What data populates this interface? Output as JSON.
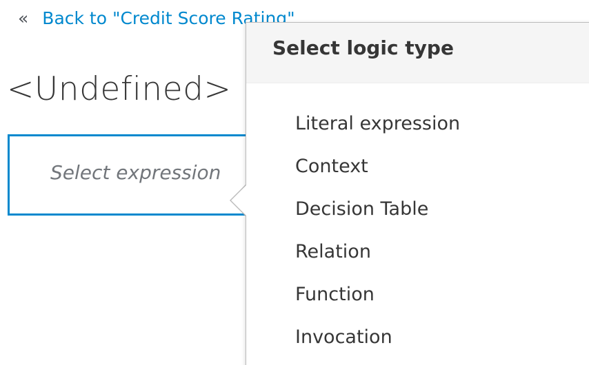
{
  "back_link": {
    "chevron": "«",
    "label": "Back to \"Credit Score Rating\""
  },
  "expression": {
    "title": "<Undefined>",
    "placeholder": "Select expression"
  },
  "popover": {
    "title": "Select logic type",
    "items": [
      {
        "label": "Literal expression"
      },
      {
        "label": "Context"
      },
      {
        "label": "Decision Table"
      },
      {
        "label": "Relation"
      },
      {
        "label": "Function"
      },
      {
        "label": "Invocation"
      }
    ]
  },
  "colors": {
    "link": "#0088ce",
    "box_border": "#0088ce",
    "text": "#363636",
    "placeholder": "#72767b",
    "popover_header_bg": "#f5f5f5"
  }
}
